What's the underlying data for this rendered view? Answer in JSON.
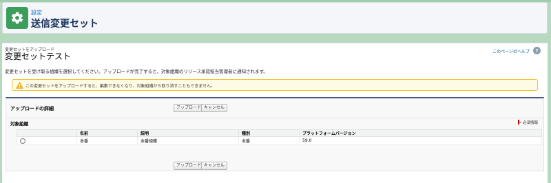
{
  "header": {
    "breadcrumb": "設定",
    "title": "送信変更セット",
    "icon": "gear-icon"
  },
  "page": {
    "subtitle": "変更セットをアップロード",
    "title": "変更セットテスト",
    "help_link": "このページのヘルプ",
    "description": "変更セットを受け取る組織を選択してください。アップロードが完了すると、対象組織のリリース承認担当管理者に通知されます。"
  },
  "warning": {
    "text": "この変更セットをアップロードすると、編集できなくなり、対象組織から取り消すこともできません。",
    "icon": "warning-icon"
  },
  "panel": {
    "title": "アップロードの詳細",
    "upload_label": "アップロード",
    "cancel_label": "キャンセル",
    "section_title": "対象組織",
    "required_info": "= 必須情報"
  },
  "table": {
    "headers": [
      "",
      "名前",
      "説明",
      "種別",
      "プラットフォームバージョン"
    ],
    "rows": [
      {
        "name": "本番",
        "description": "本番組織",
        "type": "本番",
        "platform_version": "59.0"
      }
    ]
  },
  "colors": {
    "app_icon": "#3d9e5c",
    "panel_border": "#4b5980",
    "warning_border": "#f1c232",
    "required": "#cc0000"
  }
}
